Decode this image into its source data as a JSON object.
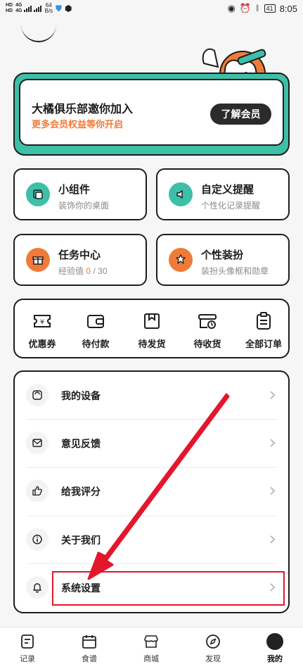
{
  "status_bar": {
    "sim1": "HD",
    "sim2": "HD",
    "net1": "4G",
    "net2": "4G",
    "speed_value": "64",
    "speed_unit": "B/s",
    "battery": "41",
    "time": "8:05"
  },
  "membership": {
    "title": "大橘俱乐部邀你加入",
    "subtitle": "更多会员权益等你开启",
    "button": "了解会员",
    "accent": "#3dbfa8",
    "highlight_color": "#f07a38"
  },
  "tiles": [
    {
      "title": "小组件",
      "subtitle": "装饰你的桌面",
      "icon": "widget-icon",
      "color": "#3dbfa8"
    },
    {
      "title": "自定义提醒",
      "subtitle": "个性化记录提醒",
      "icon": "speaker-icon",
      "color": "#3dbfa8"
    },
    {
      "title": "任务中心",
      "subtitle_prefix": "经验值 ",
      "progress_current": "0",
      "progress_sep": " / ",
      "progress_total": "30",
      "icon": "gift-icon",
      "color": "#f07a38"
    },
    {
      "title": "个性装扮",
      "subtitle": "装扮头像框和勋章",
      "icon": "badge-icon",
      "color": "#f07a38"
    }
  ],
  "orders": [
    {
      "label": "优惠券",
      "icon": "coupon-icon"
    },
    {
      "label": "待付款",
      "icon": "wallet-icon"
    },
    {
      "label": "待发货",
      "icon": "package-icon"
    },
    {
      "label": "待收货",
      "icon": "delivery-icon"
    },
    {
      "label": "全部订单",
      "icon": "clipboard-icon"
    }
  ],
  "settings": [
    {
      "label": "我的设备",
      "icon": "scale-icon"
    },
    {
      "label": "意见反馈",
      "icon": "mail-icon"
    },
    {
      "label": "给我评分",
      "icon": "thumbs-up-icon"
    },
    {
      "label": "关于我们",
      "icon": "info-icon"
    },
    {
      "label": "系统设置",
      "icon": "bell-icon"
    }
  ],
  "bottom_nav": [
    {
      "label": "记录",
      "icon": "record-icon",
      "active": false
    },
    {
      "label": "食谱",
      "icon": "calendar-icon",
      "active": false
    },
    {
      "label": "商城",
      "icon": "shop-icon",
      "active": false
    },
    {
      "label": "发现",
      "icon": "compass-icon",
      "active": false
    },
    {
      "label": "我的",
      "icon": "profile-icon",
      "active": true
    }
  ],
  "annotation_color": "#e2172d"
}
